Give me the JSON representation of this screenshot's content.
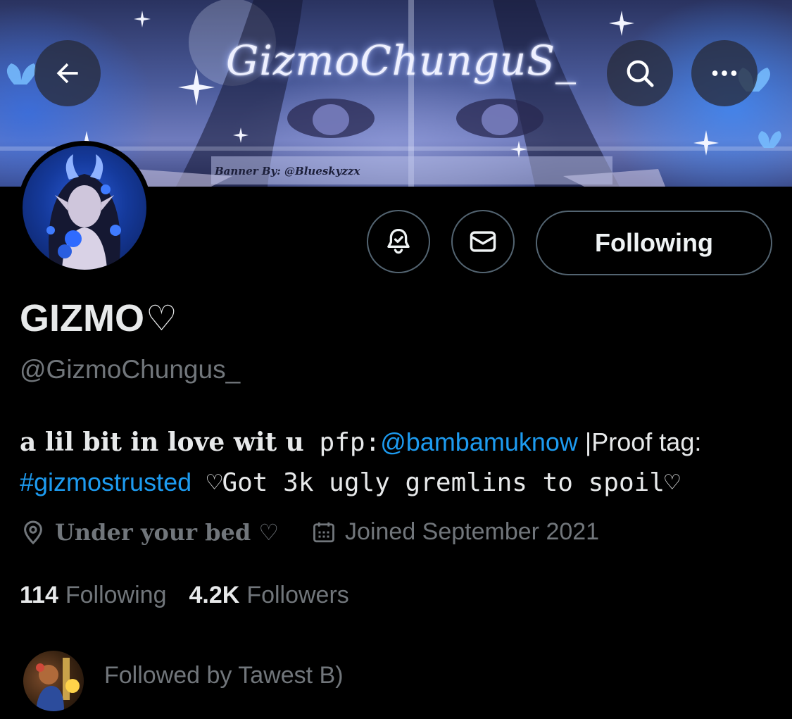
{
  "banner": {
    "title": "GizmoChunguS_",
    "credit": "Banner By: @Blueskyzzx"
  },
  "nav": {
    "back_icon": "arrow-left-icon",
    "search_icon": "search-icon",
    "more_icon": "more-horizontal-icon"
  },
  "actions": {
    "notify_icon": "bell-check-icon",
    "message_icon": "envelope-icon",
    "following_label": "Following"
  },
  "profile": {
    "name": "GIZMO",
    "name_heart": "♡",
    "handle": "@GizmoChungus_"
  },
  "bio": {
    "part1": "a lil bit in love wit u",
    "part2": " pfp:",
    "mention": "@bambamuknow",
    "part3": " |Proof tag:",
    "hashtag": "#gizmostrusted",
    "part4": " ♡Got 3k ugly gremlins to spoil♡"
  },
  "meta": {
    "location": "Under your bed ♡",
    "joined": "Joined September 2021",
    "location_icon": "location-pin-icon",
    "calendar_icon": "calendar-icon"
  },
  "stats": {
    "following_count": "114",
    "following_label": "Following",
    "followers_count": "4.2K",
    "followers_label": "Followers"
  },
  "followed_by": {
    "text": "Followed by Tawest B)"
  },
  "colors": {
    "accent": "#1d9bf0",
    "secondary_text": "#71767b",
    "primary_text": "#e7e9ea",
    "border": "#536471",
    "background": "#000000"
  }
}
